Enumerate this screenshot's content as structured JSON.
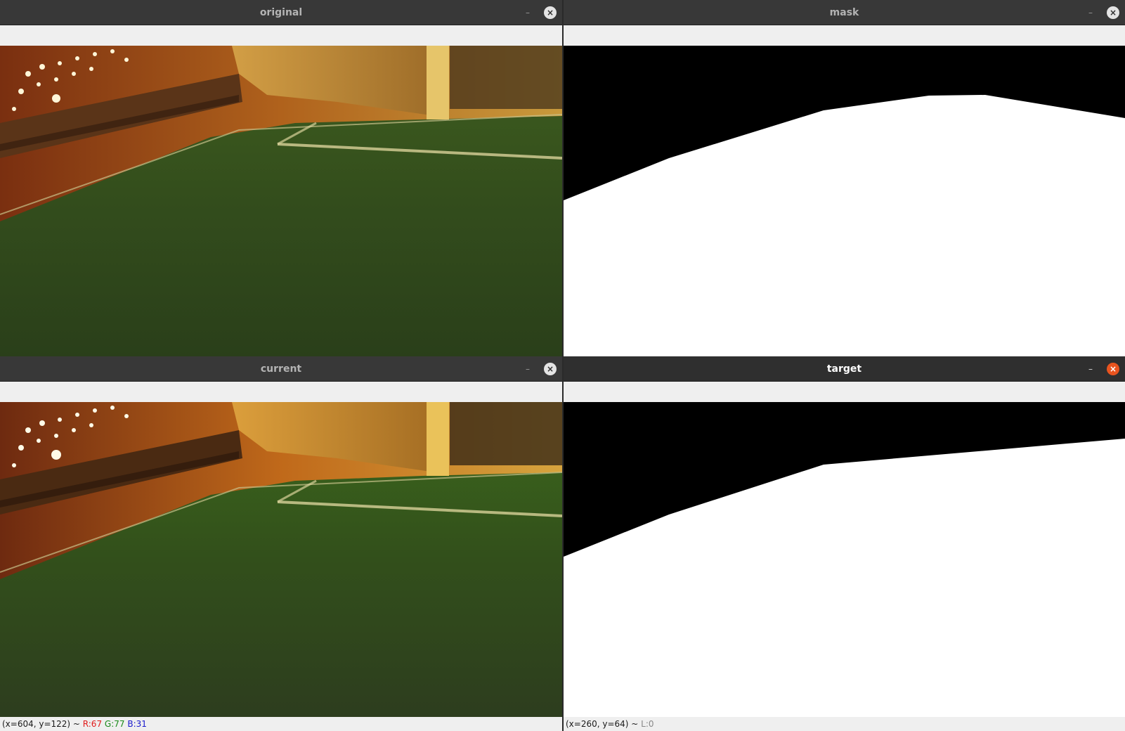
{
  "windows": {
    "original": {
      "title": "original",
      "minimize_glyph": "–",
      "close_glyph": "×"
    },
    "mask": {
      "title": "mask",
      "minimize_glyph": "–",
      "close_glyph": "×"
    },
    "current": {
      "title": "current",
      "minimize_glyph": "–",
      "close_glyph": "×"
    },
    "target": {
      "title": "target",
      "minimize_glyph": "–",
      "close_glyph": "×"
    }
  },
  "status": {
    "current": {
      "coords": "(x=604, y=122) ~ ",
      "r": "R:67",
      "g": "G:77",
      "b": "B:31"
    },
    "target": {
      "coords": "(x=260, y=64) ~ ",
      "l": "L:0"
    }
  },
  "colors": {
    "active_close": "#e9541f",
    "titlebar": "#383838",
    "field_green": "#3e5a1e",
    "stand_orange": "#8a3a10"
  }
}
